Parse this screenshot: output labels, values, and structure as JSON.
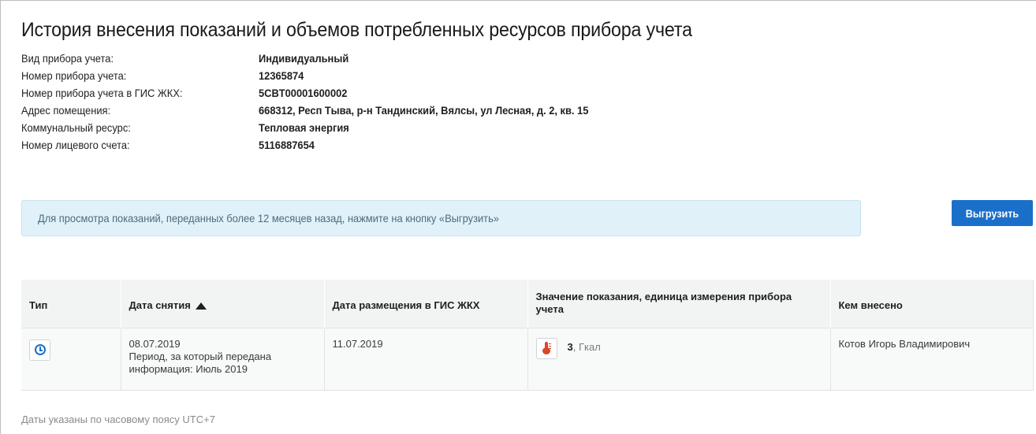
{
  "title": "История внесения показаний и объемов потребленных ресурсов прибора учета",
  "info": [
    {
      "label": "Вид прибора учета:",
      "value": "Индивидуальный"
    },
    {
      "label": "Номер прибора учета:",
      "value": "12365874"
    },
    {
      "label": "Номер прибора учета в ГИС ЖКХ:",
      "value": "5CBT00001600002"
    },
    {
      "label": "Адрес помещения:",
      "value": "668312, Респ Тыва, р-н Тандинский, Вялсы, ул Лесная, д. 2, кв. 15"
    },
    {
      "label": "Коммунальный ресурс:",
      "value": "Тепловая энергия"
    },
    {
      "label": "Номер лицевого счета:",
      "value": "5116887654"
    }
  ],
  "notice": "Для просмотра показаний, переданных более 12 месяцев назад, нажмите на кнопку «Выгрузить»",
  "export_label": "Выгрузить",
  "table": {
    "headers": {
      "type": "Тип",
      "date": "Дата снятия",
      "published": "Дата размещения в ГИС ЖКХ",
      "value": "Значение показания, единица измерения прибора учета",
      "who": "Кем внесено"
    },
    "sort": {
      "column": "date",
      "direction": "asc"
    },
    "rows": [
      {
        "type_icon": "clock-icon",
        "date": "08.07.2019",
        "period": "Период, за который передана информация: Июль 2019",
        "published": "11.07.2019",
        "value_icon": "thermometer-icon",
        "value": "3",
        "unit": ", Гкал",
        "who": "Котов Игорь Владимирович"
      }
    ]
  },
  "footer_note": "Даты указаны по часовому поясу UTC+7",
  "colors": {
    "accent": "#1a6fc9",
    "notice_bg": "#e1f1f9",
    "thermo": "#d9472b"
  }
}
